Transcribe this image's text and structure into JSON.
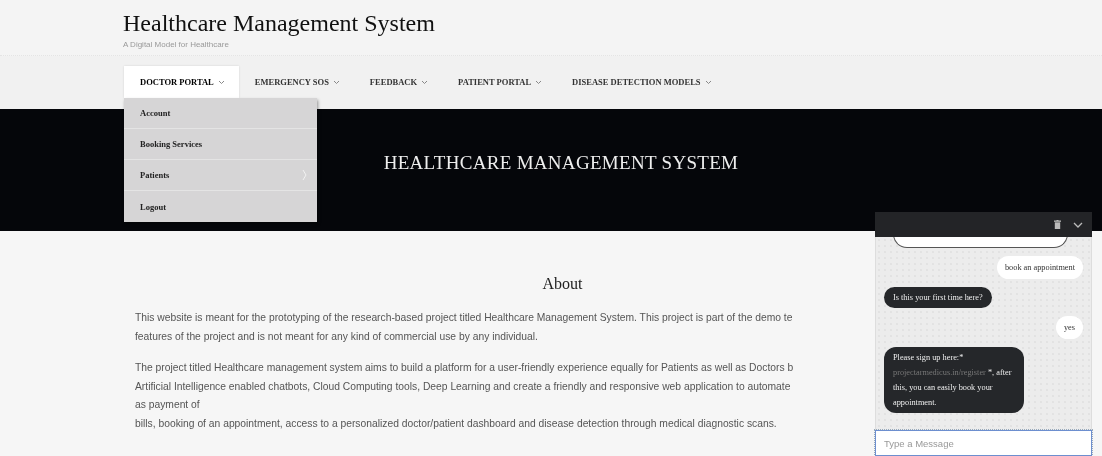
{
  "site": {
    "title": "Healthcare Management System",
    "tagline": "A Digital Model for Healthcare"
  },
  "nav": [
    {
      "label": "DOCTOR PORTAL",
      "selected": true,
      "has_menu": true
    },
    {
      "label": "EMERGENCY SOS",
      "selected": false,
      "has_menu": true
    },
    {
      "label": "FEEDBACK",
      "selected": false,
      "has_menu": true
    },
    {
      "label": "PATIENT PORTAL",
      "selected": false,
      "has_menu": true
    },
    {
      "label": "DISEASE DETECTION MODELS",
      "selected": false,
      "has_menu": true
    }
  ],
  "dropdown": [
    {
      "label": "Account",
      "has_submenu": false
    },
    {
      "label": "Booking Services",
      "has_submenu": false
    },
    {
      "label": "Patients",
      "has_submenu": true
    },
    {
      "label": "Logout",
      "has_submenu": false
    }
  ],
  "banner": {
    "title": "HEALTHCARE MANAGEMENT SYSTEM"
  },
  "about": {
    "heading": "About",
    "paragraphs": [
      [
        "This website is meant for the prototyping of the research-based project titled Healthcare Management System. This project is part of the demo te",
        "features of the project and is not meant for any kind of commercial use by any individual."
      ],
      [
        "The project titled Healthcare management system aims to build a platform for a user-friendly experience equally for Patients as well as Doctors b",
        "Artificial Intelligence enabled chatbots, Cloud Computing tools, Deep Learning and create a friendly and responsive web application to automate",
        "as payment of",
        "bills, booking of an appointment, access to a personalized doctor/patient dashboard and disease detection through medical diagnostic scans."
      ]
    ]
  },
  "chat": {
    "messages": [
      {
        "kind": "user",
        "parts": [
          {
            "kind": "text",
            "text": "book an appointment"
          }
        ]
      },
      {
        "kind": "bot",
        "parts": [
          {
            "kind": "text",
            "text": "Is this your first time here?"
          }
        ]
      },
      {
        "kind": "user",
        "parts": [
          {
            "kind": "text",
            "text": "yes"
          }
        ]
      },
      {
        "kind": "bot",
        "parts": [
          {
            "kind": "text",
            "text": "Please sign up here:* "
          },
          {
            "kind": "link",
            "text": "projectarmedicus.in/register"
          },
          {
            "kind": "text",
            "text": " *, after this, you can easily book your appointment."
          }
        ]
      }
    ],
    "placeholder": "Type a Message"
  }
}
